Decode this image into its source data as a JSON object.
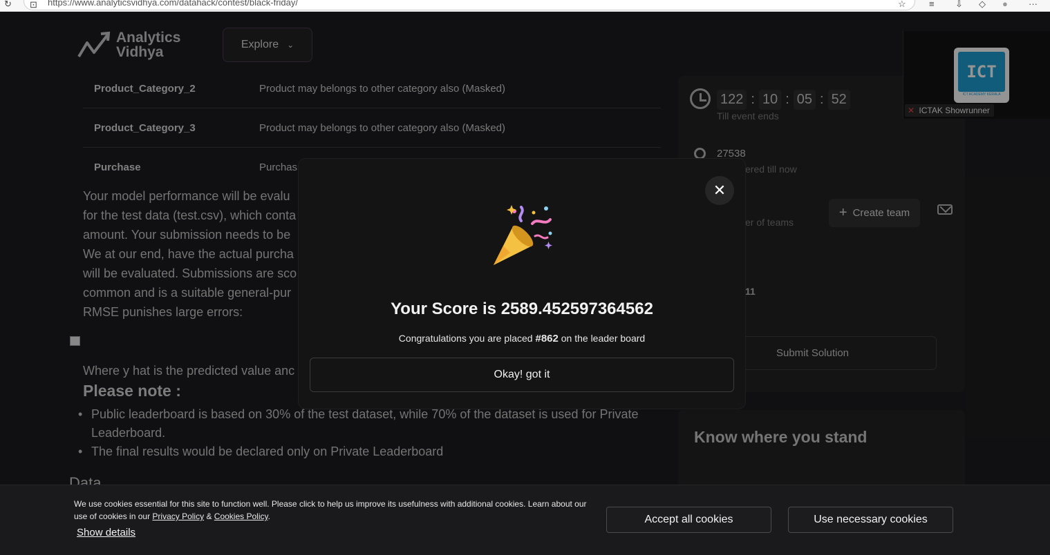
{
  "browser": {
    "url": "https://www.analyticsvidhya.com/datahack/contest/black-friday/"
  },
  "header": {
    "logo_line1": "Analytics",
    "logo_line2": "Vidhya",
    "explore_label": "Explore"
  },
  "table_rows": [
    {
      "key": "Product_Category_2",
      "value": "Product may belongs to other category also (Masked)"
    },
    {
      "key": "Product_Category_3",
      "value": "Product may belongs to other category also (Masked)"
    },
    {
      "key": "Purchase",
      "value": "Purchas"
    }
  ],
  "content": {
    "para_lines": [
      "Your model performance will be evalu",
      "for the test data (test.csv), which conta",
      "amount. Your submission needs to be",
      "We at our end, have the actual purcha",
      "will be evaluated. Submissions are sco",
      "common and is a suitable general-pur",
      "RMSE punishes large errors:"
    ],
    "where_text": "Where y hat is the predicted value anc",
    "please_note": "Please note :",
    "bullets": [
      "Public leaderboard is based on 30% of the test dataset, while 70% of the dataset is used for Private Leaderboard.",
      "The final results would be declared only on Private Leaderboard"
    ],
    "data_heading": "Data"
  },
  "sidebar": {
    "timer": {
      "days": "122",
      "hours": "10",
      "minutes": "05",
      "seconds": "52"
    },
    "timer_label": "Till event ends",
    "registered_count": "27538",
    "registered_label": "ered till now",
    "teams_label": "er of teams",
    "create_team_label": "Create team",
    "fragment": "11",
    "submit_label": "Submit Solution",
    "know_heading": "Know where you stand"
  },
  "video_tile": {
    "name": "ICTAK Showrunner",
    "logo_text": "ICT",
    "logo_tag": "ICT ACADEMY KERALA"
  },
  "modal": {
    "score_text": "Your Score is 2589.452597364562",
    "congrats_before": "Congratulations you are placed",
    "rank": "#862",
    "congrats_after": "on the leader board",
    "okay_label": "Okay! got it"
  },
  "cookie": {
    "text_main": "We use cookies essential for this site to function well. Please click to help us improve its usefulness with additional cookies. Learn about our use of cookies in our",
    "privacy_link": "Privacy Policy",
    "amp": "&",
    "cookies_link": "Cookies Policy",
    "period": ".",
    "show_details": "Show details",
    "accept_label": "Accept all cookies",
    "necessary_label": "Use necessary cookies"
  }
}
